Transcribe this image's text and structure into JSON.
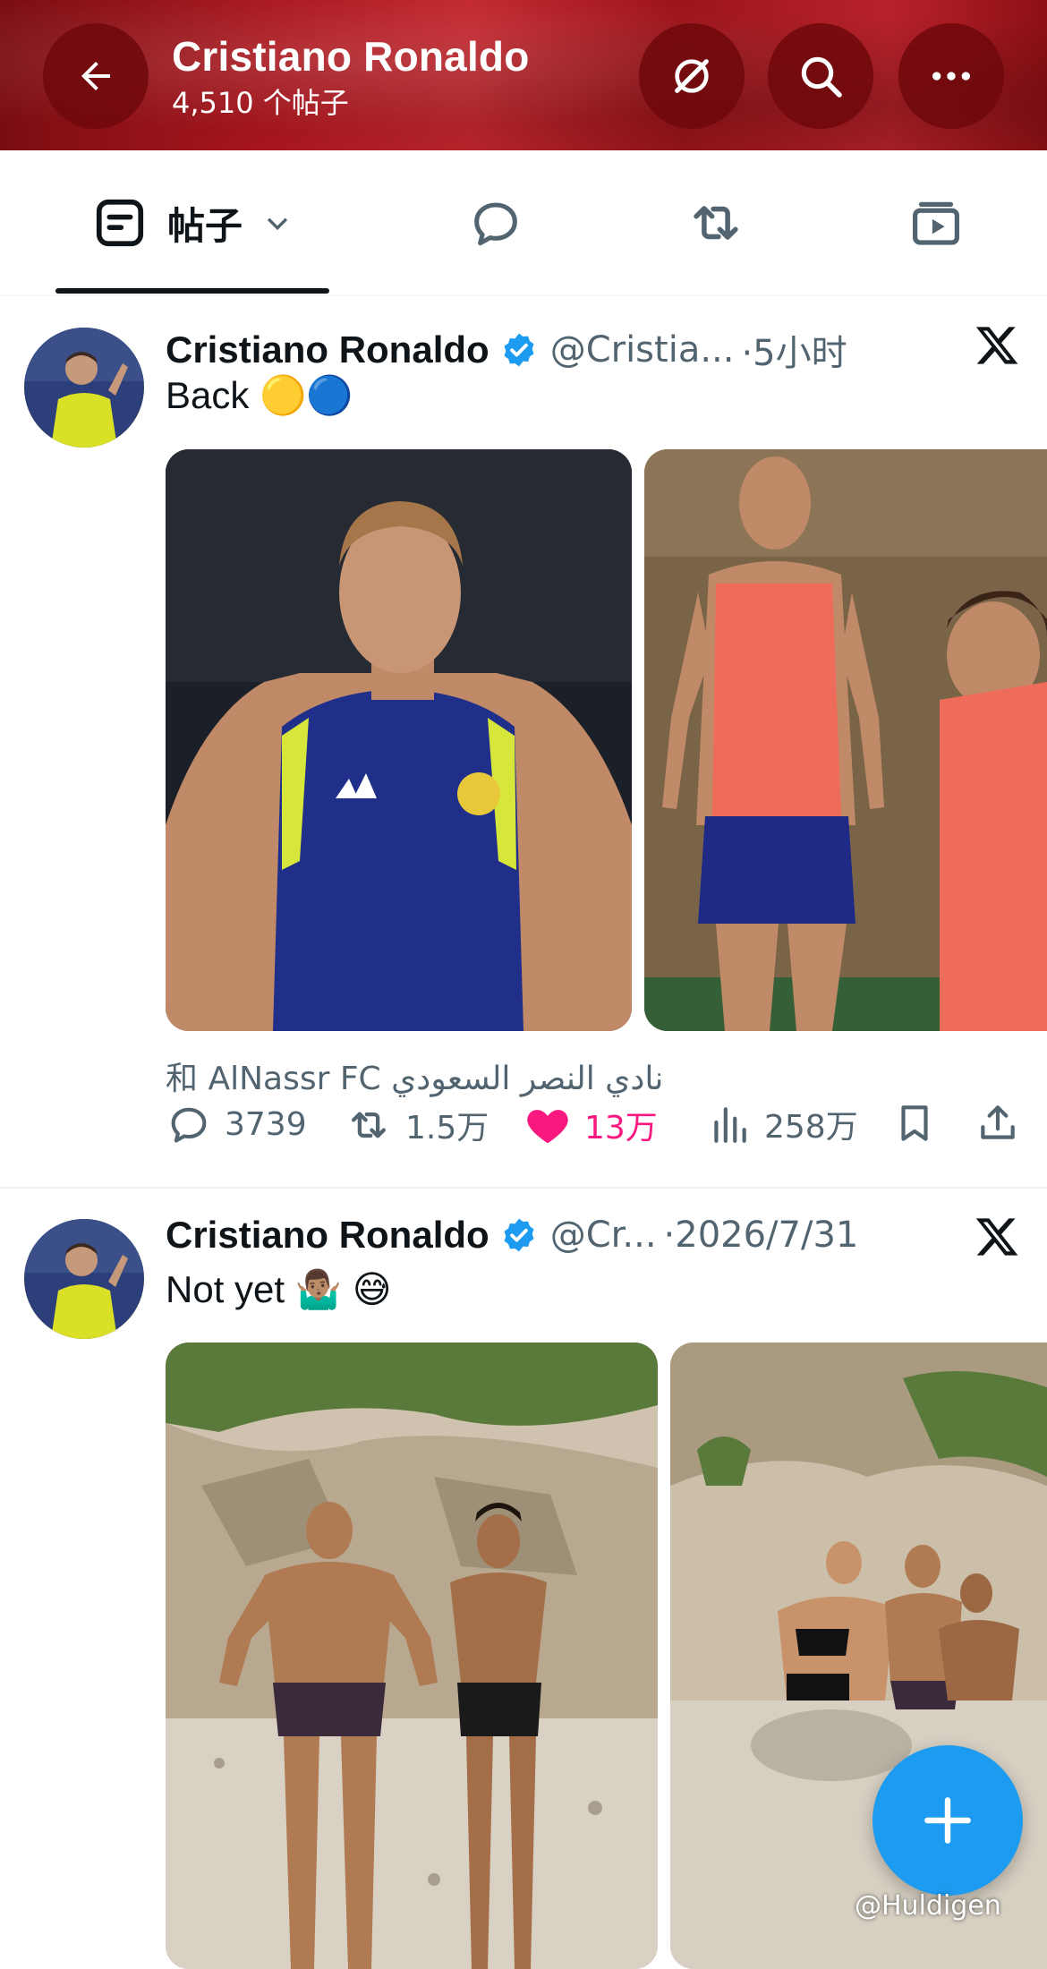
{
  "header": {
    "name": "Cristiano Ronaldo",
    "post_count": "4,510 个帖子"
  },
  "tabs": [
    {
      "label": "帖子",
      "icon": "posts-icon"
    },
    {
      "icon": "replies-icon"
    },
    {
      "icon": "reposts-icon"
    },
    {
      "icon": "media-icon"
    }
  ],
  "posts": [
    {
      "name": "Cristiano Ronaldo",
      "handle": "@Cristia...",
      "time": "·5小时",
      "text": "Back 🟡🔵",
      "with": "和 AlNassr FC نادي النصر السعودي",
      "stats": {
        "replies": "3739",
        "reposts": "1.5万",
        "likes": "13万",
        "views": "258万"
      }
    },
    {
      "name": "Cristiano Ronaldo",
      "handle": "@Cr...",
      "time": "·2026/7/31",
      "text": "Not yet 🤷🏽‍♂️ 😅"
    }
  ],
  "colors": {
    "like": "#f91880",
    "accent": "#1d9bf0",
    "verified": "#1d9bf0"
  },
  "watermark": "@Huldigen"
}
